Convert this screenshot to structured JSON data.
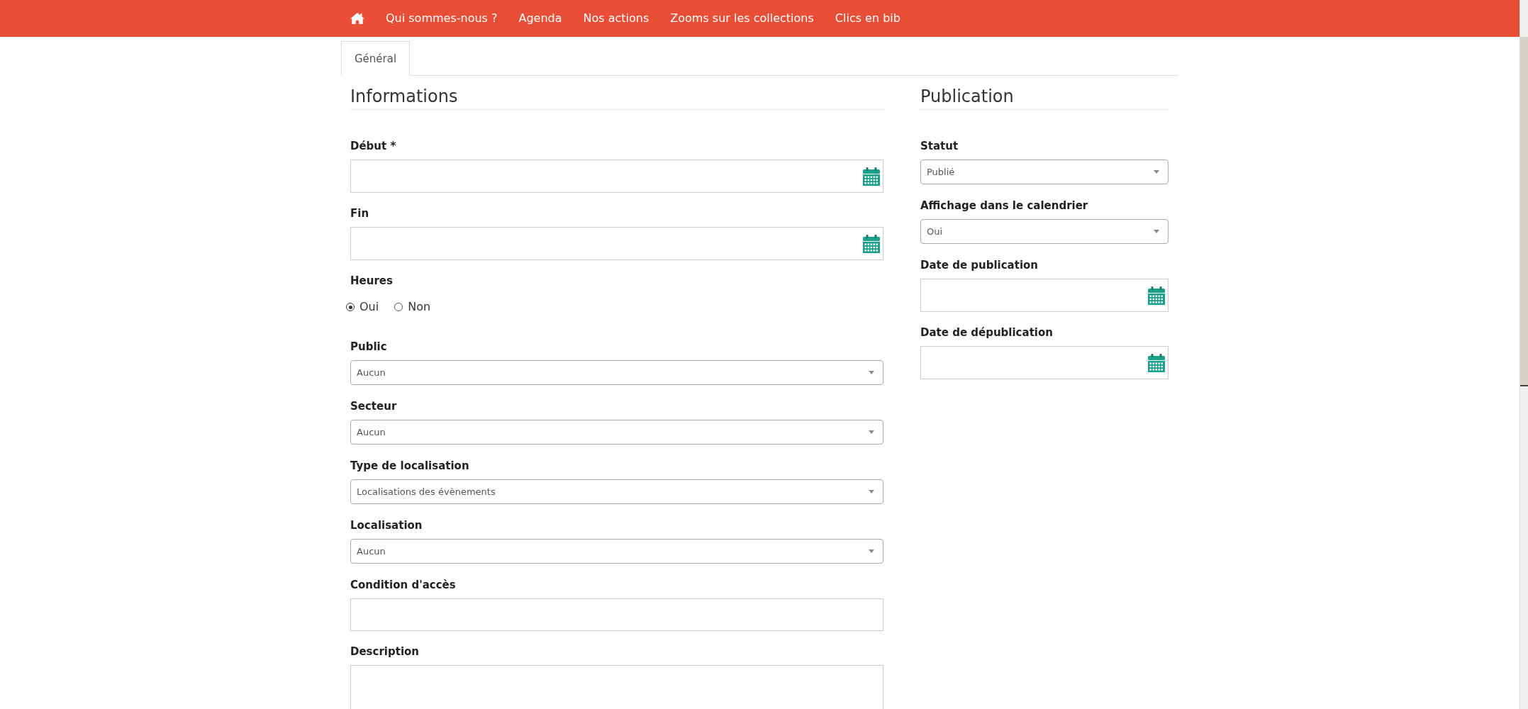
{
  "nav": {
    "links": [
      "Qui sommes-nous ?",
      "Agenda",
      "Nos actions",
      "Zooms sur les collections",
      "Clics en bib"
    ]
  },
  "tabs": [
    {
      "label": "Général",
      "selected": true
    }
  ],
  "sections": [
    {
      "title": "Informations",
      "fields": [
        {
          "kind": "date",
          "label": "Début *"
        },
        {
          "kind": "date",
          "label": "Fin"
        },
        {
          "kind": "radio",
          "label": "Heures",
          "options": [
            {
              "label": "Oui",
              "selected": true
            },
            {
              "label": "Non",
              "selected": false
            }
          ]
        },
        {
          "kind": "select",
          "label": "Public",
          "value": "Aucun"
        },
        {
          "kind": "select",
          "label": "Secteur",
          "value": "Aucun"
        },
        {
          "kind": "select",
          "label": "Type de localisation",
          "value": "Localisations des évènements"
        },
        {
          "kind": "select",
          "label": "Localisation",
          "value": "Aucun"
        },
        {
          "kind": "text",
          "label": "Condition d'accès"
        },
        {
          "kind": "textarea",
          "label": "Description"
        }
      ]
    },
    {
      "title": "Publication",
      "fields": [
        {
          "kind": "select",
          "label": "Statut",
          "value": "Publié"
        },
        {
          "kind": "select",
          "label": "Affichage dans le calendrier",
          "value": "Oui"
        },
        {
          "kind": "date",
          "label": "Date de publication"
        },
        {
          "kind": "date",
          "label": "Date de dépublication"
        }
      ]
    }
  ]
}
